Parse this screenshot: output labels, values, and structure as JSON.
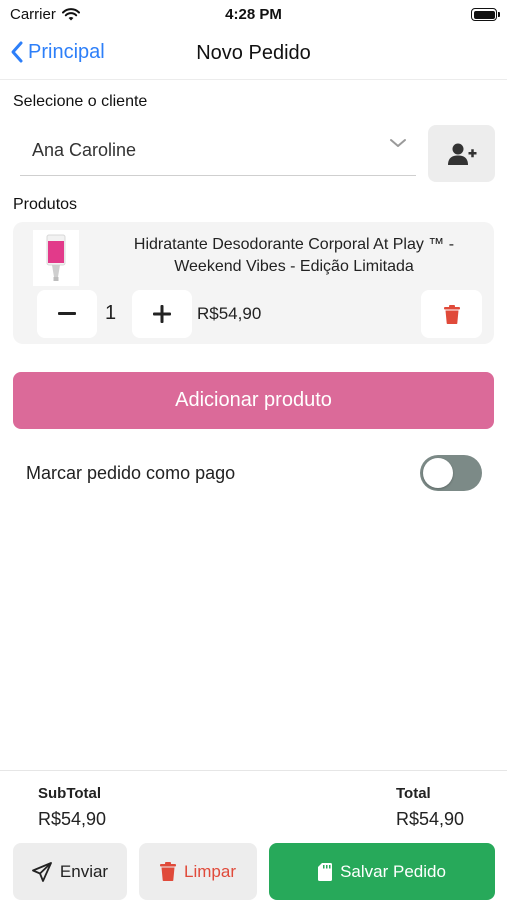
{
  "status_bar": {
    "carrier": "Carrier",
    "time": "4:28 PM"
  },
  "nav": {
    "back_label": "Principal",
    "title": "Novo Pedido"
  },
  "client": {
    "section_label": "Selecione o cliente",
    "selected_value": "Ana Caroline"
  },
  "products": {
    "section_label": "Produtos",
    "items": [
      {
        "name": "Hidratante Desodorante Corporal At Play ™ - Weekend Vibes - Edição Limitada",
        "quantity": "1",
        "price": "R$54,90",
        "thumb_color": "#e23a8a"
      }
    ],
    "add_button_label": "Adicionar produto"
  },
  "paid": {
    "label": "Marcar pedido como pago",
    "checked": false
  },
  "summary": {
    "subtotal_label": "SubTotal",
    "subtotal_value": "R$54,90",
    "total_label": "Total",
    "total_value": "R$54,90"
  },
  "actions": {
    "send_label": "Enviar",
    "clear_label": "Limpar",
    "save_label": "Salvar Pedido"
  },
  "colors": {
    "accent_blue": "#2d7ff9",
    "primary_pink": "#db6a99",
    "danger_red": "#e04a3a",
    "success_green": "#27a95a",
    "toggle_off": "#7c8a87"
  }
}
